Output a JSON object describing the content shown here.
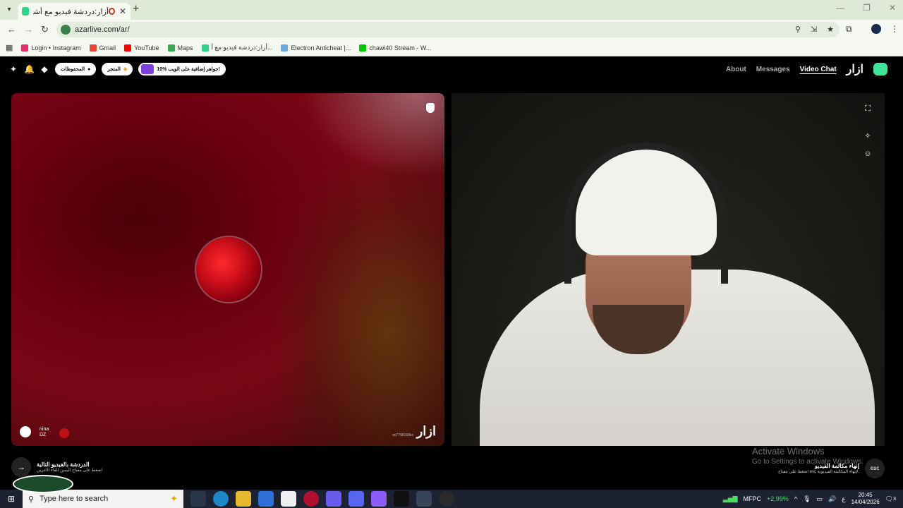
{
  "browser": {
    "tab_title": "أزار:دردشة فيديو مع أشخاص",
    "url": "azarlive.com/ar/",
    "bookmarks": [
      {
        "label": "Login • Instagram",
        "color": "#e1306c"
      },
      {
        "label": "Gmail",
        "color": "#ea4335"
      },
      {
        "label": "YouTube",
        "color": "#ff0000"
      },
      {
        "label": "Maps",
        "color": "#34a853"
      },
      {
        "label": "أزار:دردشة فيديو مع أ...",
        "color": "#2fd38a"
      },
      {
        "label": "Electron Anticheat |...",
        "color": "#6fa8dc"
      },
      {
        "label": "chawi40 Stream - W...",
        "color": "#00c800"
      }
    ]
  },
  "site": {
    "pill_favorites": "المحفوظات",
    "pill_store": "المتجر",
    "pill_promo": "10% جواهر إضافية على الويب!",
    "nav": {
      "about": "About",
      "messages": "Messages",
      "video_chat": "Video Chat"
    },
    "logo_text": "ازار"
  },
  "left_panel": {
    "peer_name": "nina",
    "peer_country": "DZ",
    "panel_logo": "ازار",
    "session_id": "sn7798198ks"
  },
  "controls": {
    "next_title": "الدردشة بالفيديو التالية",
    "next_hint": "اضغط على مفتاح اليمين للقاء الآخرين",
    "esc_title": "إنهاء مكالمة الفيديو",
    "esc_hint": "اضغط على مفتاح esc لإنهاء المكالمة الفيديوية.",
    "esc_label": "esc"
  },
  "watermark": {
    "line1": "Activate Windows",
    "line2": "Go to Settings to activate Windows."
  },
  "taskbar": {
    "search_placeholder": "Type here to search",
    "stock": "MFPC",
    "stock_change": "+2,99%",
    "time": "20:45",
    "date": "14/04/2026",
    "lang": "ع",
    "notifications": "3"
  }
}
